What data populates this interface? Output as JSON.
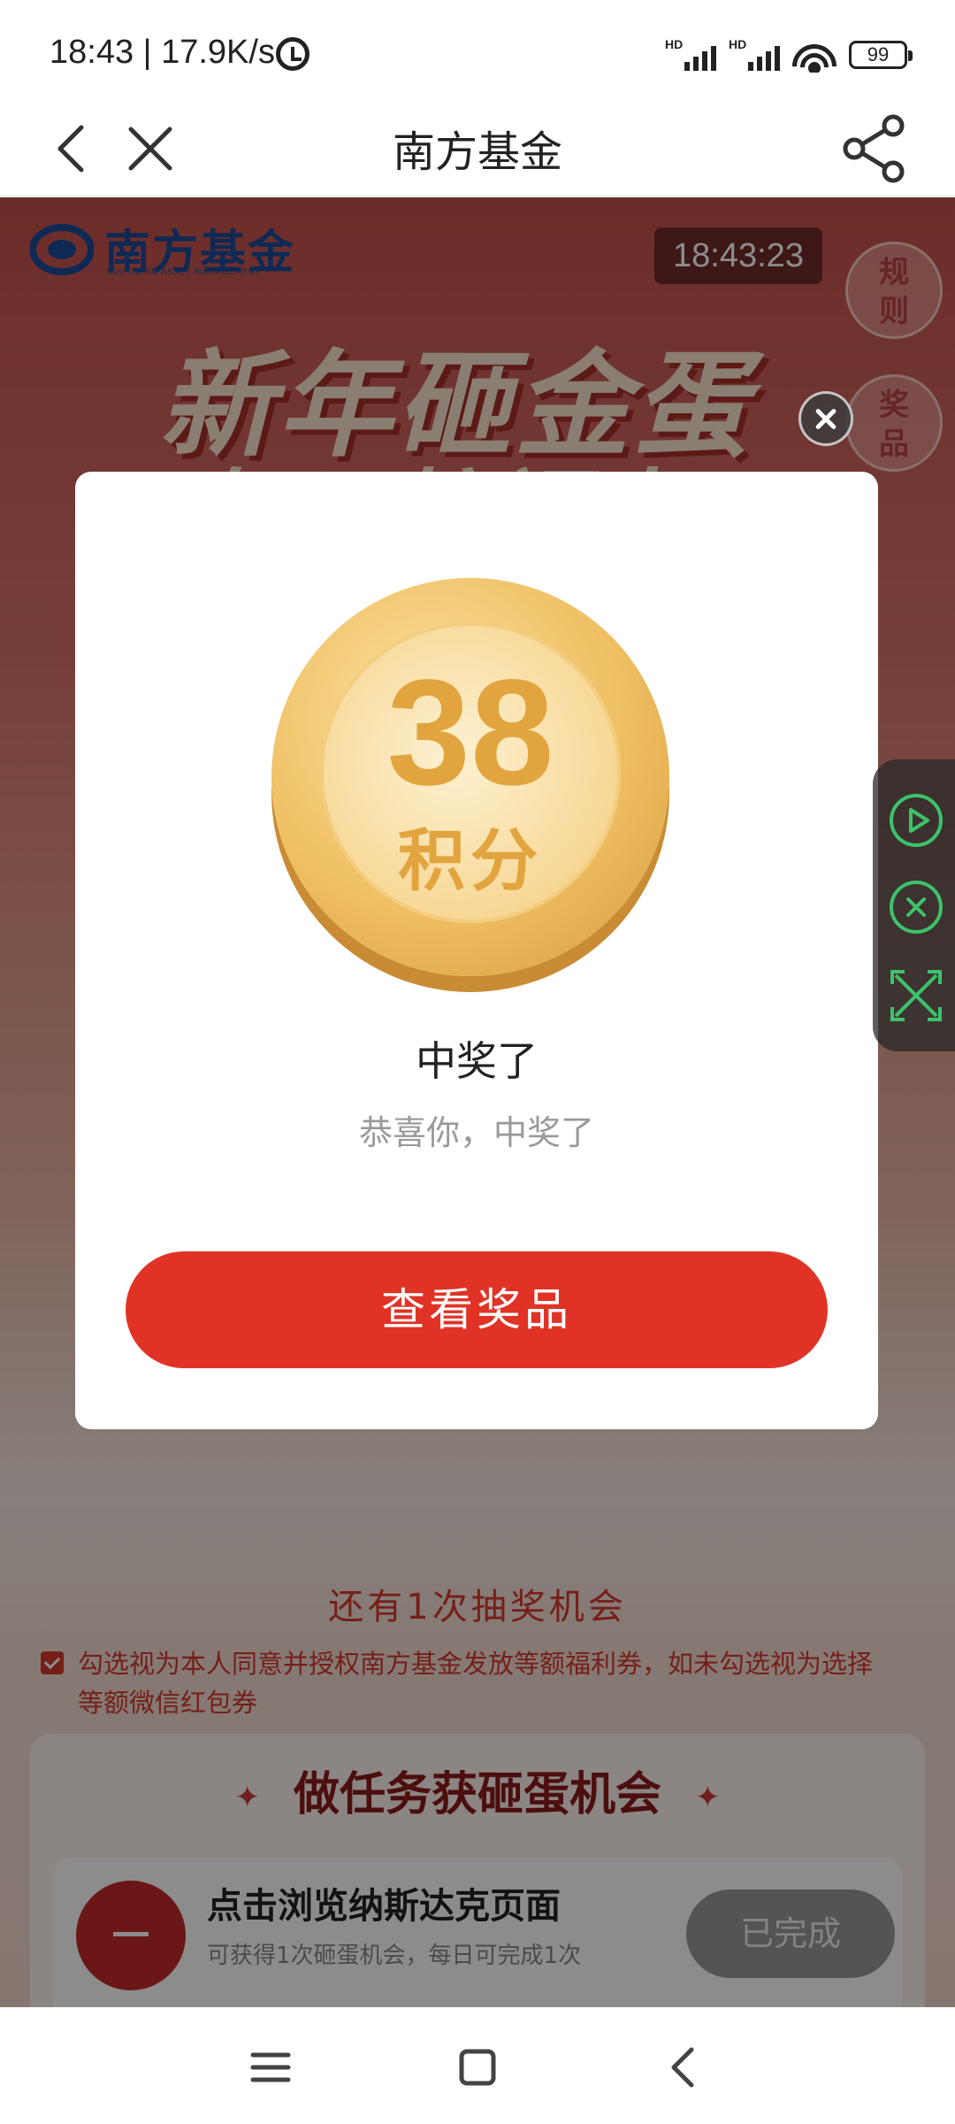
{
  "status_bar": {
    "time_speed": "18:43 | 17.9K/s",
    "network_1": "HD",
    "network_2": "HD",
    "battery": "99"
  },
  "nav": {
    "title": "南方基金"
  },
  "banner": {
    "brand_name": "南方基金",
    "brand_sub": "SOUTHERN ASSET MANAGEMENT",
    "clock": "18:43:23",
    "rules_label": "规则",
    "prize_label": "奖品",
    "headline": "新年砸金蛋",
    "headline2": "好运接福来"
  },
  "dialog": {
    "points_value": "38",
    "points_unit": "积分",
    "title": "中奖了",
    "subtitle": "恭喜你，中奖了",
    "button": "查看奖品"
  },
  "page": {
    "chances": "还有1次抽奖机会",
    "consent": "勾选视为本人同意并授权南方基金发放等额福利券，如未勾选视为选择等额微信红包券",
    "consent_checked": true
  },
  "tasks": {
    "title": "做任务获砸蛋机会",
    "items": [
      {
        "name": "点击浏览纳斯达克页面",
        "desc": "可获得1次砸蛋机会，每日可完成1次",
        "status": "已完成"
      }
    ]
  },
  "colors": {
    "accent_red": "#e03326",
    "gold": "#e2a43e",
    "brand_blue": "#1a4c9a",
    "float_green": "#3cc36b"
  },
  "icons": {
    "back": "chevron-left-icon",
    "close": "close-icon",
    "share": "share-icon",
    "play": "play-icon",
    "stop": "close-circle-icon",
    "expand": "expand-icon"
  }
}
